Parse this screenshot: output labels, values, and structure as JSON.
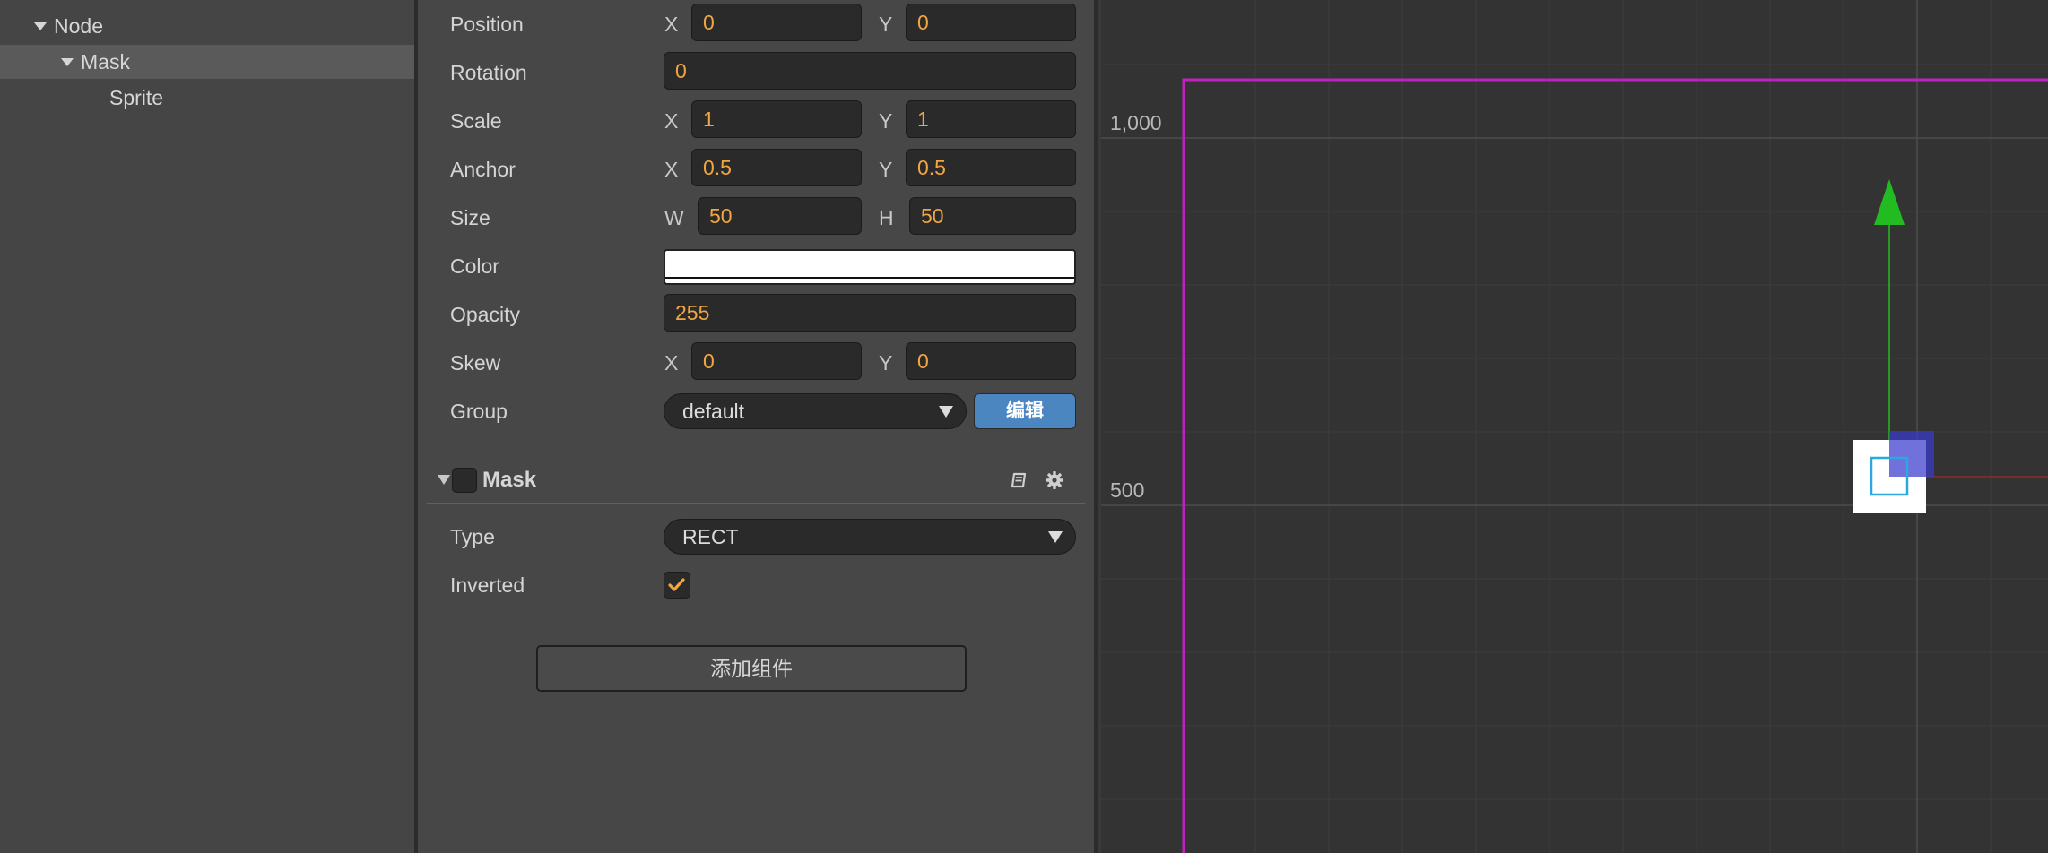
{
  "hierarchy": {
    "items": [
      {
        "label": "Node",
        "level": 0,
        "expanded": true,
        "selected": false
      },
      {
        "label": "Mask",
        "level": 1,
        "expanded": true,
        "selected": true
      },
      {
        "label": "Sprite",
        "level": 2,
        "expanded": false,
        "selected": false
      }
    ]
  },
  "inspector": {
    "position": {
      "label": "Position",
      "x_axis": "X",
      "x": "0",
      "y_axis": "Y",
      "y": "0"
    },
    "rotation": {
      "label": "Rotation",
      "value": "0"
    },
    "scale": {
      "label": "Scale",
      "x_axis": "X",
      "x": "1",
      "y_axis": "Y",
      "y": "1"
    },
    "anchor": {
      "label": "Anchor",
      "x_axis": "X",
      "x": "0.5",
      "y_axis": "Y",
      "y": "0.5"
    },
    "size": {
      "label": "Size",
      "w_axis": "W",
      "w": "50",
      "h_axis": "H",
      "h": "50"
    },
    "color": {
      "label": "Color",
      "value": "#ffffff"
    },
    "opacity": {
      "label": "Opacity",
      "value": "255"
    },
    "skew": {
      "label": "Skew",
      "x_axis": "X",
      "x": "0",
      "y_axis": "Y",
      "y": "0"
    },
    "group": {
      "label": "Group",
      "value": "default",
      "edit_button": "编辑"
    },
    "mask_component": {
      "title": "Mask",
      "enabled": false,
      "type": {
        "label": "Type",
        "value": "RECT"
      },
      "inverted": {
        "label": "Inverted",
        "checked": true
      }
    },
    "add_component_button": "添加组件"
  },
  "scene": {
    "ruler_labels": [
      "1,000",
      "500"
    ],
    "colors": {
      "design_frame": "#c020c0",
      "y_axis_gizmo": "#22bb22",
      "x_axis_line": "#8a2a2a",
      "selection": "#2aa8e0"
    }
  }
}
